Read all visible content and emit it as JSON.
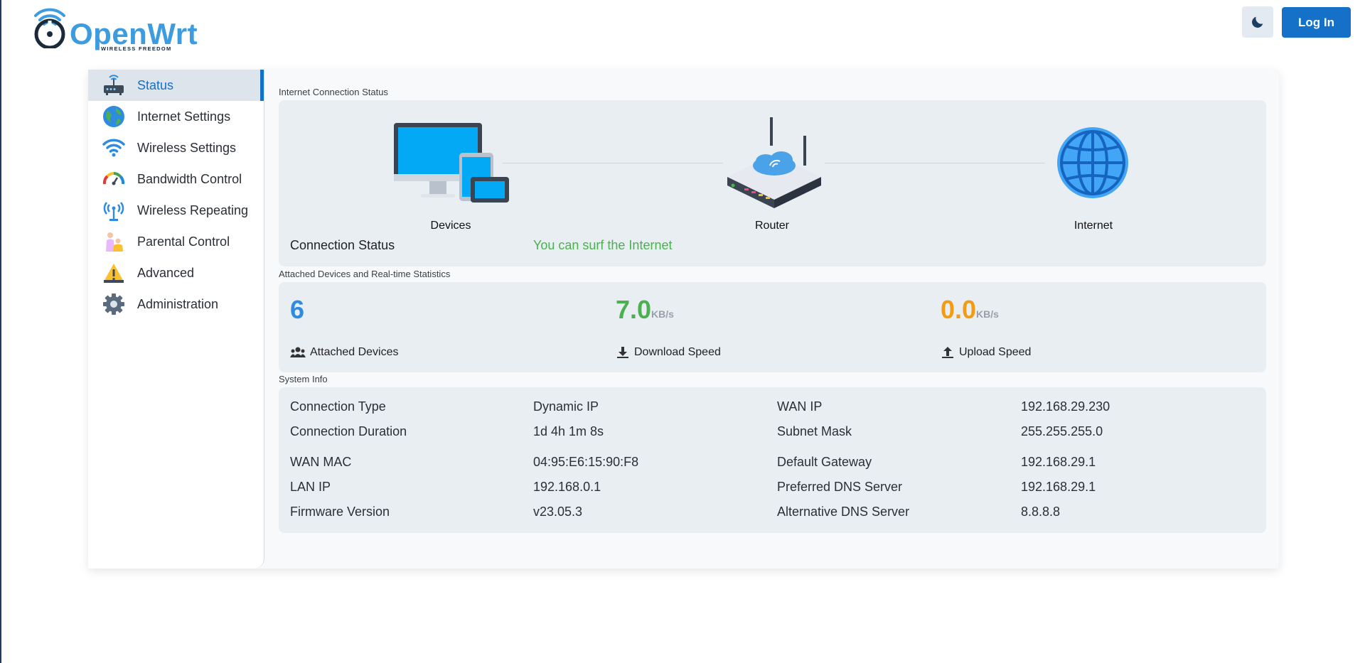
{
  "header": {
    "logo_text": "OpenWrt",
    "logo_tagline": "WIRELESS FREEDOM",
    "theme_icon": "moon-icon",
    "login_label": "Log In"
  },
  "colors": {
    "primary": "#1570c8",
    "logo": "#3d9be0",
    "success": "#4caf50",
    "stat_blue": "#2d8ce0",
    "stat_green": "#4caf50",
    "stat_orange": "#f39c12"
  },
  "sidebar": {
    "items": [
      {
        "label": "Status",
        "icon": "router-icon",
        "active": true
      },
      {
        "label": "Internet Settings",
        "icon": "globe-icon"
      },
      {
        "label": "Wireless Settings",
        "icon": "wifi-icon"
      },
      {
        "label": "Bandwidth Control",
        "icon": "gauge-icon"
      },
      {
        "label": "Wireless Repeating",
        "icon": "antenna-icon"
      },
      {
        "label": "Parental Control",
        "icon": "family-icon"
      },
      {
        "label": "Advanced",
        "icon": "warning-icon"
      },
      {
        "label": "Administration",
        "icon": "gear-icon"
      }
    ]
  },
  "connection": {
    "section_title": "Internet Connection Status",
    "devices_label": "Devices",
    "router_label": "Router",
    "internet_label": "Internet",
    "status_key": "Connection Status",
    "status_value": "You can surf the Internet"
  },
  "stats": {
    "section_title": "Attached Devices and Real-time Statistics",
    "attached": {
      "value": "6",
      "label": "Attached Devices"
    },
    "download": {
      "value": "7.0",
      "unit": "KB/s",
      "label": "Download Speed"
    },
    "upload": {
      "value": "0.0",
      "unit": "KB/s",
      "label": "Upload Speed"
    }
  },
  "system": {
    "section_title": "System Info",
    "rows": [
      {
        "k1": "Connection Type",
        "v1": "Dynamic IP",
        "k2": "WAN IP",
        "v2": "192.168.29.230"
      },
      {
        "k1": "Connection Duration",
        "v1": "1d 4h 1m 8s",
        "k2": "Subnet Mask",
        "v2": "255.255.255.0"
      },
      {
        "k1": "WAN MAC",
        "v1": "04:95:E6:15:90:F8",
        "k2": "Default Gateway",
        "v2": "192.168.29.1"
      },
      {
        "k1": "LAN IP",
        "v1": "192.168.0.1",
        "k2": "Preferred DNS Server",
        "v2": "192.168.29.1"
      },
      {
        "k1": "Firmware Version",
        "v1": "v23.05.3",
        "k2": "Alternative DNS Server",
        "v2": "8.8.8.8"
      }
    ]
  }
}
